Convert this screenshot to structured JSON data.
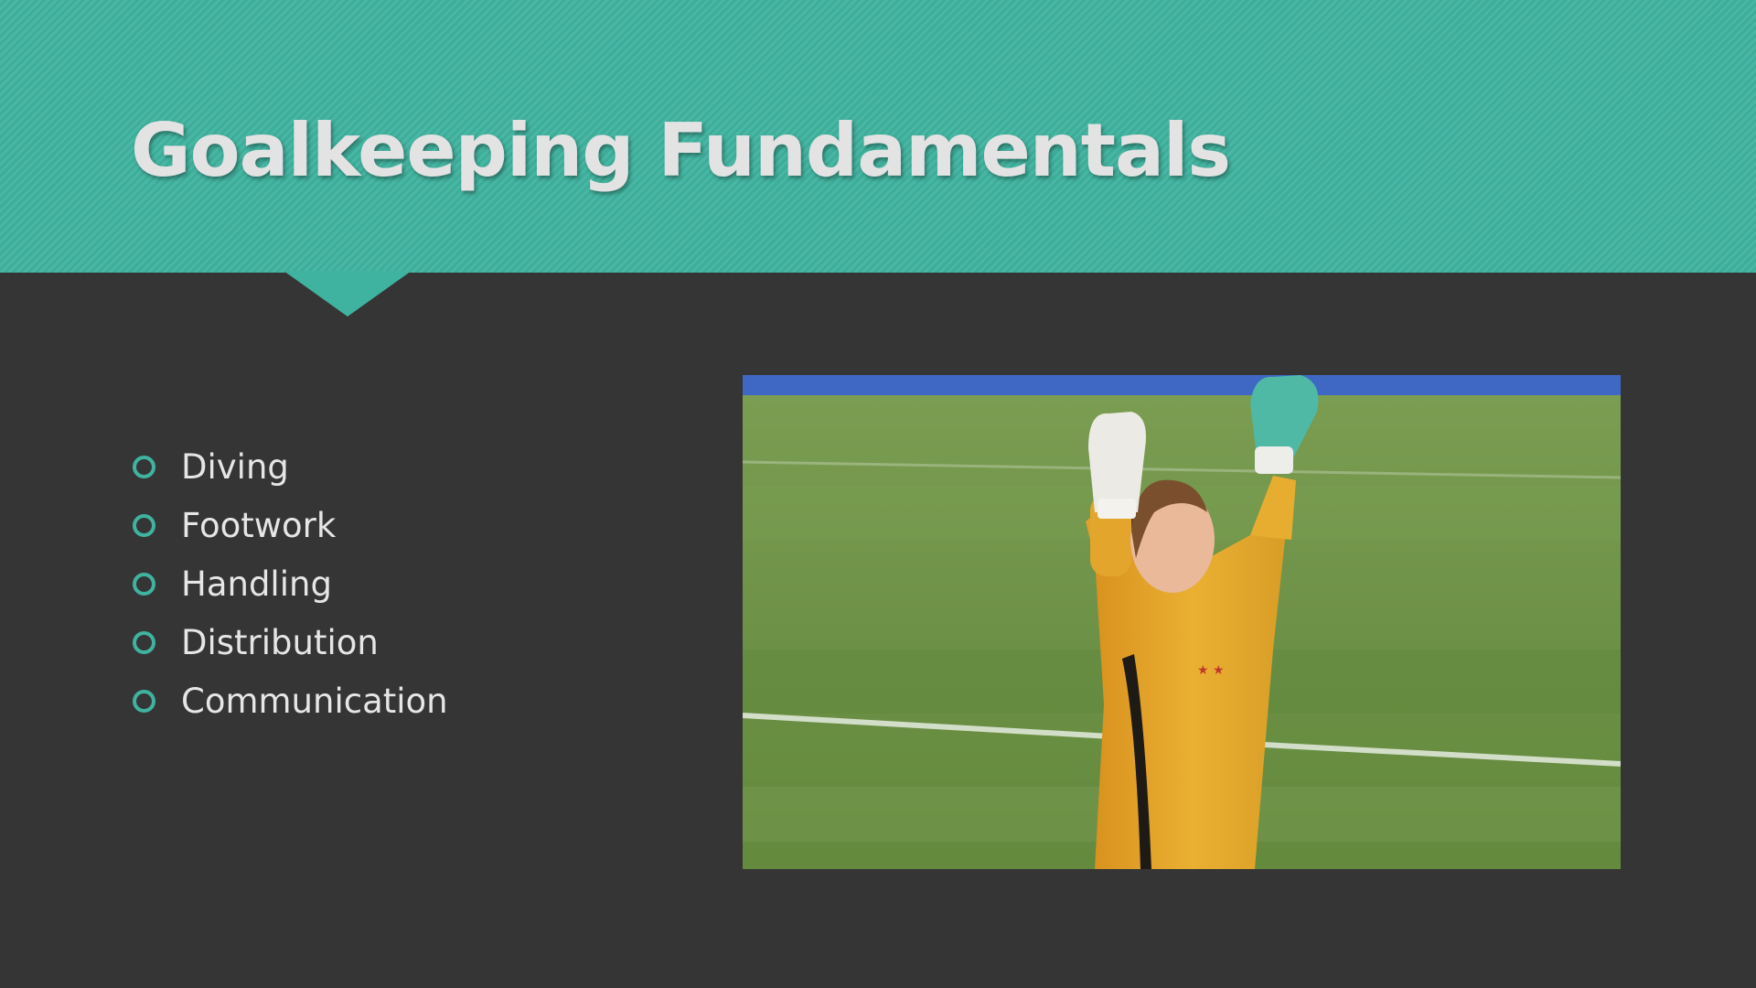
{
  "slide": {
    "title": "Goalkeeping Fundamentals",
    "bullets": [
      "Diving",
      "Footwork",
      "Handling",
      "Distribution",
      "Communication"
    ],
    "photo": {
      "subject": "goalkeeper-celebrating-photo",
      "sky_color": "#3f68c4",
      "pitch_color": "#6d9146",
      "jersey_color": "#e8a82d"
    }
  },
  "theme": {
    "accent": "#3fb39f",
    "background": "#353535",
    "title_color": "#e3e3e3",
    "text_color": "#e6e6e6"
  }
}
